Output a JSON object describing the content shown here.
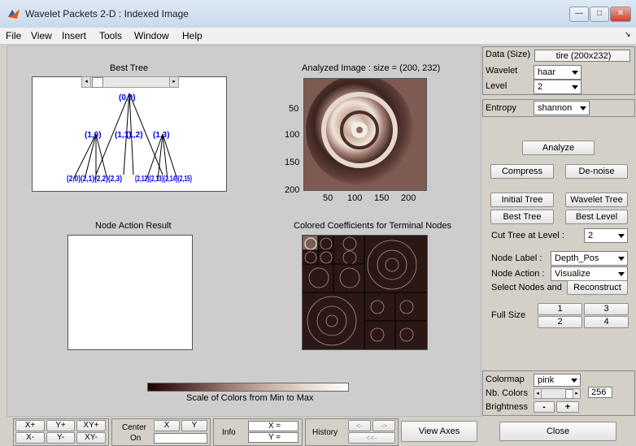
{
  "window": {
    "title": "Wavelet Packets 2-D : Indexed Image",
    "minimize": "—",
    "maximize": "□",
    "close": "✕"
  },
  "menu": [
    "File",
    "View",
    "Insert",
    "Tools",
    "Window",
    "Help"
  ],
  "menu_overflow": "↘",
  "plots": {
    "best_tree_title": "Best Tree",
    "analyzed_title": "Analyzed Image : size = (200, 232)",
    "node_action_title": "Node Action Result",
    "colored_title": "Colored Coefficients for Terminal Nodes",
    "analyzed_yticks": [
      "50",
      "100",
      "150",
      "200"
    ],
    "analyzed_xticks": [
      "50",
      "100",
      "150",
      "200"
    ],
    "colorbar_label": "Scale of Colors from Min to Max"
  },
  "tree": {
    "root": "(0,0)",
    "level1": [
      "(1,0)",
      "(1,1)",
      "(1,2)",
      "(1,3)"
    ],
    "level2_left": "(2,0)(2,1)(2,2)(2,3)",
    "level2_right": "(2,12)(2,13)(2,14)(2,15)"
  },
  "right": {
    "data_label": "Data  (Size)",
    "data_value": "tire  (200x232)",
    "wavelet_label": "Wavelet",
    "wavelet_value": "haar",
    "level_label": "Level",
    "level_value": "2",
    "entropy_label": "Entropy",
    "entropy_value": "shannon",
    "analyze": "Analyze",
    "compress": "Compress",
    "denoise": "De-noise",
    "initial_tree": "Initial Tree",
    "wavelet_tree": "Wavelet Tree",
    "best_tree": "Best Tree",
    "best_level": "Best Level",
    "cut_label": "Cut Tree at Level :",
    "cut_value": "2",
    "node_label_label": "Node Label :",
    "node_label_value": "Depth_Pos",
    "node_action_label": "Node Action :",
    "node_action_value": "Visualize",
    "select_nodes": "Select Nodes and",
    "reconstruct": "Reconstruct",
    "full_size": "Full Size",
    "fs1": "1",
    "fs2": "2",
    "fs3": "3",
    "fs4": "4",
    "colormap_label": "Colormap",
    "colormap_value": "pink",
    "ncolors_label": "Nb. Colors",
    "ncolors_value": "256",
    "brightness_label": "Brightness",
    "bright_minus": "-",
    "bright_plus": "+",
    "close": "Close"
  },
  "bottom": {
    "xplus": "X+",
    "yplus": "Y+",
    "xyplus": "XY+",
    "xminus": "X-",
    "yminus": "Y-",
    "xyminus": "XY-",
    "center": "Center",
    "on": "On",
    "cx": "X",
    "cy": "Y",
    "info": "Info",
    "xeq": "X =",
    "yeq": "Y =",
    "history": "History",
    "hprev": "<-",
    "hnext": "->",
    "hfirst": "<<-",
    "view_axes": "View Axes"
  },
  "colors": {
    "tree_blue": "#0000e6",
    "colormap": "pink"
  }
}
